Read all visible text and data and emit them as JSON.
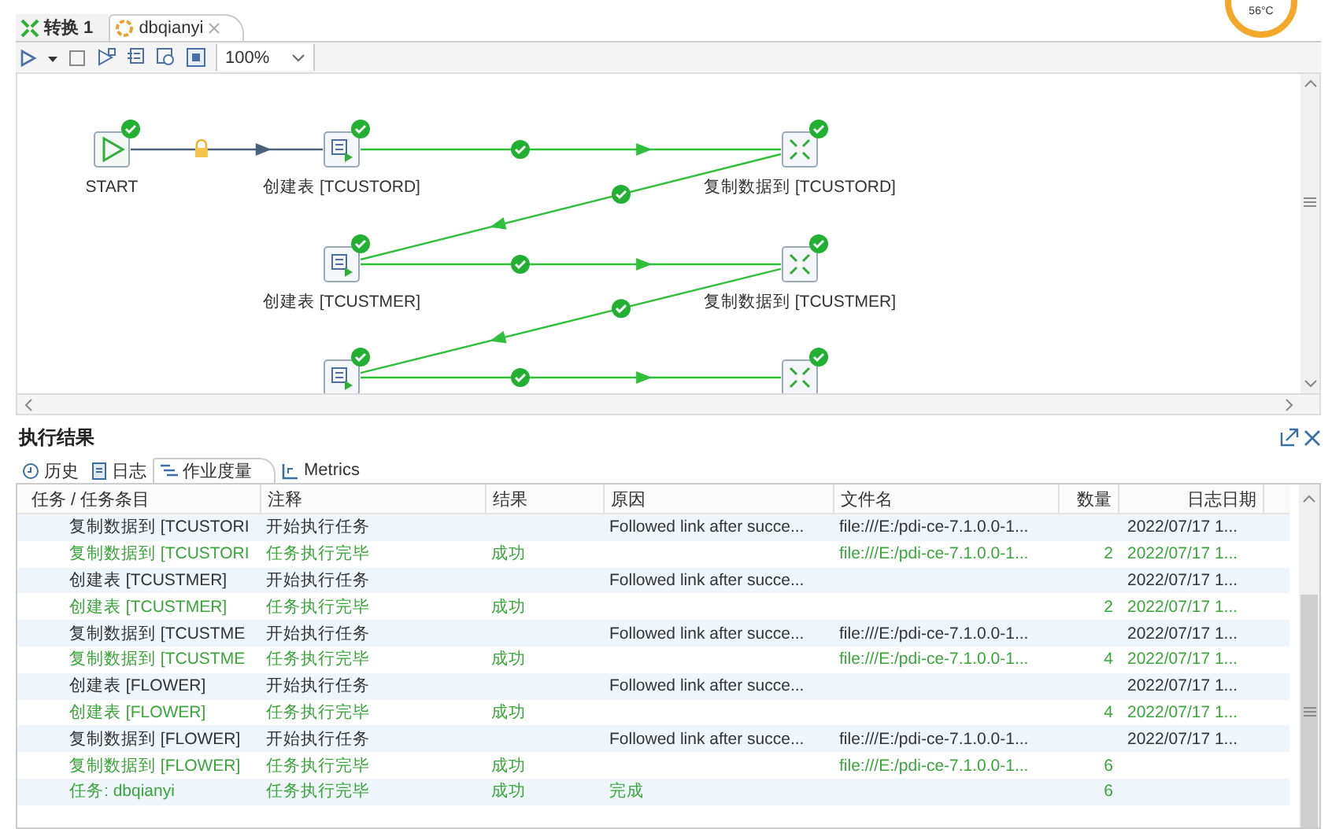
{
  "editor_tabs": [
    {
      "label": "转换 1",
      "kind": "transformation",
      "selected": false,
      "closable": false
    },
    {
      "label": "dbqianyi",
      "kind": "job",
      "selected": true,
      "closable": true
    }
  ],
  "toolbar": {
    "zoom": "100%"
  },
  "temperature": "56°C",
  "canvas": {
    "nodes": [
      {
        "label": "START",
        "kind": "start",
        "ok": true
      },
      {
        "label": "创建表 [TCUSTORD]",
        "kind": "sql",
        "ok": true
      },
      {
        "label": "复制数据到 [TCUSTORD]",
        "kind": "copy",
        "ok": true
      },
      {
        "label": "创建表 [TCUSTMER]",
        "kind": "sql",
        "ok": true
      },
      {
        "label": "复制数据到 [TCUSTMER]",
        "kind": "copy",
        "ok": true
      },
      {
        "kind": "sql",
        "ok": true
      },
      {
        "kind": "copy",
        "ok": true
      }
    ],
    "hops": [
      {
        "kind": "unconditional"
      },
      {
        "kind": "success"
      },
      {
        "kind": "success"
      },
      {
        "kind": "success"
      },
      {
        "kind": "success"
      },
      {
        "kind": "success"
      }
    ]
  },
  "results": {
    "title": "执行结果",
    "tabs": [
      {
        "label": "历史",
        "kind": "history",
        "selected": false
      },
      {
        "label": "日志",
        "kind": "log",
        "selected": false
      },
      {
        "label": "作业度量",
        "kind": "metrics-tree",
        "selected": true
      },
      {
        "label": "Metrics",
        "kind": "chart",
        "selected": false
      }
    ],
    "columns": [
      "任务 / 任务条目",
      "注释",
      "结果",
      "原因",
      "文件名",
      "数量",
      "日志日期"
    ],
    "rows": [
      {
        "kind": "start",
        "task": "复制数据到 [TCUSTORI",
        "note": "开始执行任务",
        "reason": "Followed link after succe...",
        "file": "file:///E:/pdi-ce-7.1.0.0-1...",
        "date": "2022/07/17 1..."
      },
      {
        "kind": "end",
        "task": "复制数据到 [TCUSTORI",
        "note": "任务执行完毕",
        "result": "成功",
        "file": "file:///E:/pdi-ce-7.1.0.0-1...",
        "count": "2",
        "date": "2022/07/17 1..."
      },
      {
        "kind": "start",
        "task": "创建表 [TCUSTMER]",
        "note": "开始执行任务",
        "reason": "Followed link after succe...",
        "date": "2022/07/17 1..."
      },
      {
        "kind": "end",
        "task": "创建表 [TCUSTMER]",
        "note": "任务执行完毕",
        "result": "成功",
        "count": "2",
        "date": "2022/07/17 1..."
      },
      {
        "kind": "start",
        "task": "复制数据到 [TCUSTME",
        "note": "开始执行任务",
        "reason": "Followed link after succe...",
        "file": "file:///E:/pdi-ce-7.1.0.0-1...",
        "date": "2022/07/17 1..."
      },
      {
        "kind": "end",
        "task": "复制数据到 [TCUSTME",
        "note": "任务执行完毕",
        "result": "成功",
        "file": "file:///E:/pdi-ce-7.1.0.0-1...",
        "count": "4",
        "date": "2022/07/17 1..."
      },
      {
        "kind": "start",
        "task": "创建表 [FLOWER]",
        "note": "开始执行任务",
        "reason": "Followed link after succe...",
        "date": "2022/07/17 1..."
      },
      {
        "kind": "end",
        "task": "创建表 [FLOWER]",
        "note": "任务执行完毕",
        "result": "成功",
        "count": "4",
        "date": "2022/07/17 1..."
      },
      {
        "kind": "start",
        "task": "复制数据到 [FLOWER]",
        "note": "开始执行任务",
        "reason": "Followed link after succe...",
        "file": "file:///E:/pdi-ce-7.1.0.0-1...",
        "date": "2022/07/17 1..."
      },
      {
        "kind": "end",
        "task": "复制数据到 [FLOWER]",
        "note": "任务执行完毕",
        "result": "成功",
        "file": "file:///E:/pdi-ce-7.1.0.0-1...",
        "count": "6"
      },
      {
        "kind": "job",
        "task": "任务: dbqianyi",
        "note": "任务执行完毕",
        "result": "成功",
        "reason": "完成",
        "count": "6"
      }
    ]
  }
}
